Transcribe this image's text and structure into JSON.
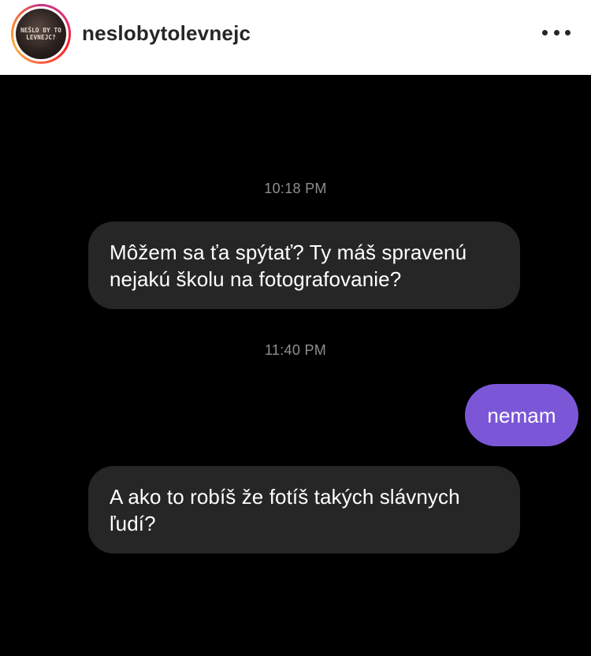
{
  "header": {
    "username": "neslobytolevnejc",
    "avatar_text": [
      "NEŠLO BY TO",
      "LEVNEJC?"
    ]
  },
  "messages": [
    {
      "type": "timestamp",
      "text": "10:18 PM"
    },
    {
      "type": "received",
      "text": "Môžem sa ťa spýtať? Ty máš spravenú nejakú školu na fotografovanie?"
    },
    {
      "type": "timestamp",
      "text": "11:40 PM"
    },
    {
      "type": "sent",
      "text": "nemam"
    },
    {
      "type": "received",
      "text": "A ako to robíš že fotíš takých slávnych ľudí?"
    }
  ],
  "colors": {
    "chat_background": "#000000",
    "received_bubble": "#262626",
    "sent_bubble": "#7b57d8",
    "timestamp_text": "#8e8e8e"
  }
}
